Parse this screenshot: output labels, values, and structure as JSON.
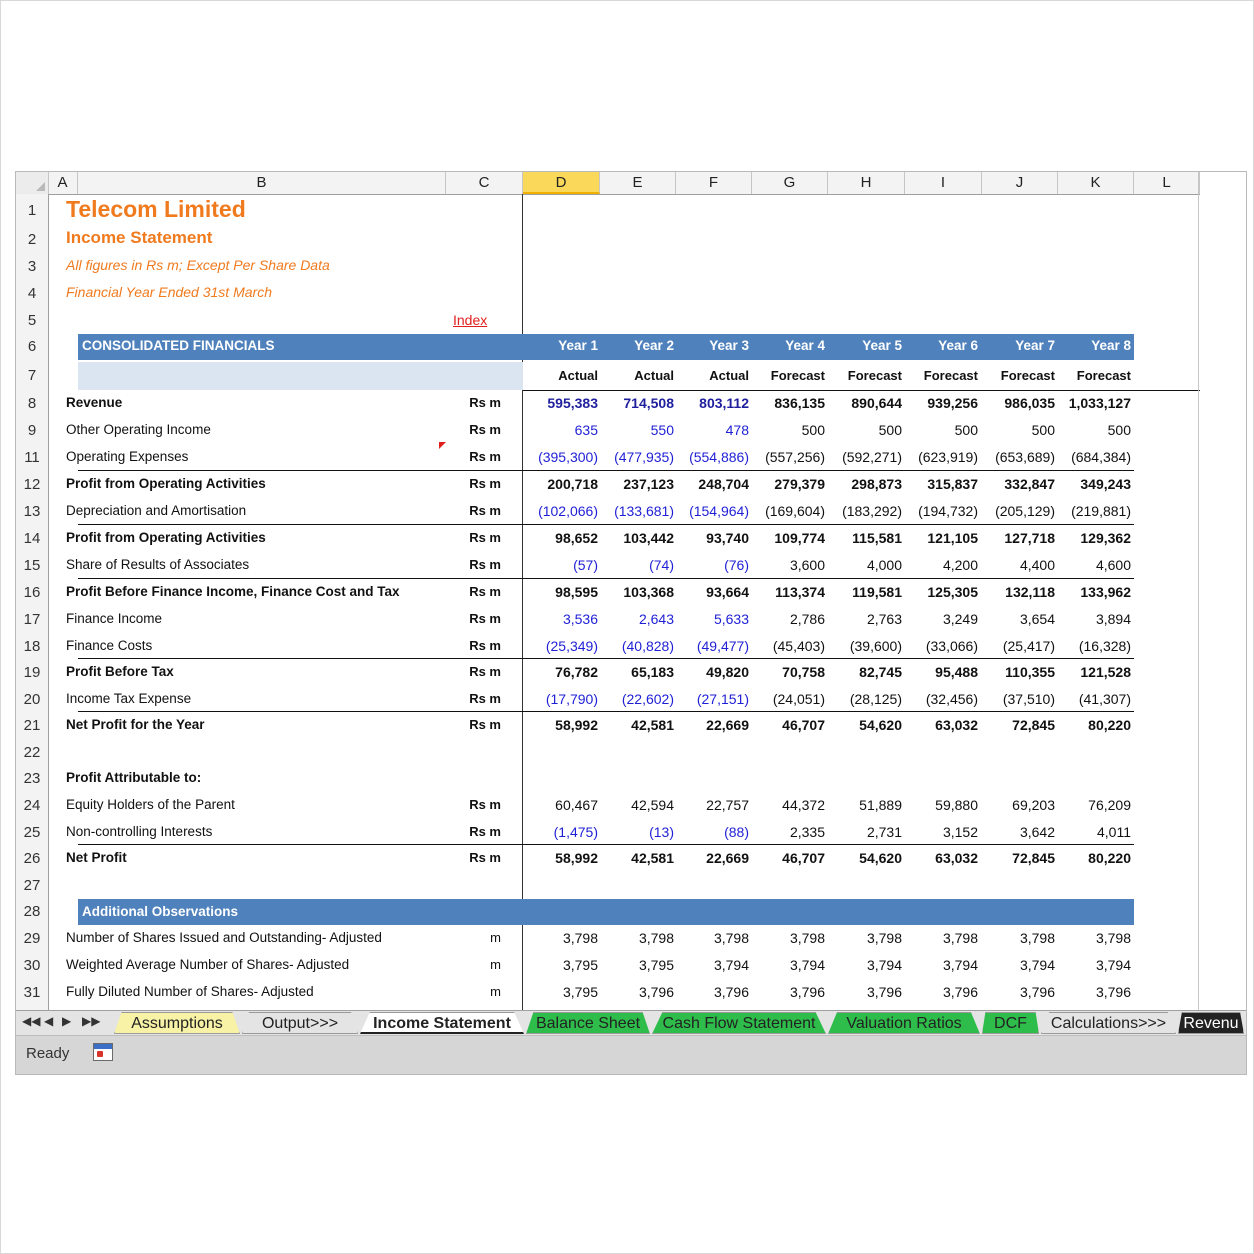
{
  "columns": [
    "A",
    "B",
    "C",
    "D",
    "E",
    "F",
    "G",
    "H",
    "I",
    "J",
    "K",
    "L"
  ],
  "selected_column": "D",
  "row_numbers": [
    "1",
    "2",
    "3",
    "4",
    "5",
    "6",
    "7",
    "8",
    "9",
    "11",
    "12",
    "13",
    "14",
    "15",
    "16",
    "17",
    "18",
    "19",
    "20",
    "21",
    "22",
    "23",
    "24",
    "25",
    "26",
    "27",
    "28",
    "29",
    "30",
    "31"
  ],
  "title": {
    "company": "Telecom Limited",
    "statement": "Income Statement",
    "note1": "All figures in Rs m; Except Per Share Data",
    "note2": "Financial Year Ended 31st March",
    "index_link": "Index"
  },
  "header": {
    "section": "CONSOLIDATED FINANCIALS",
    "years": [
      "Year 1",
      "Year 2",
      "Year 3",
      "Year 4",
      "Year 5",
      "Year 6",
      "Year 7",
      "Year 8"
    ],
    "types": [
      "Actual",
      "Actual",
      "Actual",
      "Forecast",
      "Forecast",
      "Forecast",
      "Forecast",
      "Forecast"
    ]
  },
  "rows": [
    {
      "label": "Revenue",
      "unit": "Rs m",
      "bold": true,
      "values": [
        "595,383",
        "714,508",
        "803,112",
        "836,135",
        "890,644",
        "939,256",
        "986,035",
        "1,033,127"
      ]
    },
    {
      "label": "Other Operating Income",
      "unit": "Rs m",
      "bold": false,
      "values": [
        "635",
        "550",
        "478",
        "500",
        "500",
        "500",
        "500",
        "500"
      ]
    },
    {
      "label": "Operating Expenses",
      "unit": "Rs m",
      "bold": false,
      "values": [
        "(395,300)",
        "(477,935)",
        "(554,886)",
        "(557,256)",
        "(592,271)",
        "(623,919)",
        "(653,689)",
        "(684,384)"
      ]
    },
    {
      "label": "Profit from Operating Activities",
      "unit": "Rs m",
      "bold": true,
      "values": [
        "200,718",
        "237,123",
        "248,704",
        "279,379",
        "298,873",
        "315,837",
        "332,847",
        "349,243"
      ]
    },
    {
      "label": "Depreciation and Amortisation",
      "unit": "Rs m",
      "bold": false,
      "values": [
        "(102,066)",
        "(133,681)",
        "(154,964)",
        "(169,604)",
        "(183,292)",
        "(194,732)",
        "(205,129)",
        "(219,881)"
      ]
    },
    {
      "label": "Profit from Operating Activities",
      "unit": "Rs m",
      "bold": true,
      "values": [
        "98,652",
        "103,442",
        "93,740",
        "109,774",
        "115,581",
        "121,105",
        "127,718",
        "129,362"
      ]
    },
    {
      "label": "Share of Results of Associates",
      "unit": "Rs m",
      "bold": false,
      "values": [
        "(57)",
        "(74)",
        "(76)",
        "3,600",
        "4,000",
        "4,200",
        "4,400",
        "4,600"
      ]
    },
    {
      "label": "Profit Before Finance Income, Finance Cost and Tax",
      "unit": "Rs m",
      "bold": true,
      "values": [
        "98,595",
        "103,368",
        "93,664",
        "113,374",
        "119,581",
        "125,305",
        "132,118",
        "133,962"
      ]
    },
    {
      "label": "Finance Income",
      "unit": "Rs m",
      "bold": false,
      "values": [
        "3,536",
        "2,643",
        "5,633",
        "2,786",
        "2,763",
        "3,249",
        "3,654",
        "3,894"
      ]
    },
    {
      "label": "Finance Costs",
      "unit": "Rs m",
      "bold": false,
      "values": [
        "(25,349)",
        "(40,828)",
        "(49,477)",
        "(45,403)",
        "(39,600)",
        "(33,066)",
        "(25,417)",
        "(16,328)"
      ]
    },
    {
      "label": "Profit Before Tax",
      "unit": "Rs m",
      "bold": true,
      "values": [
        "76,782",
        "65,183",
        "49,820",
        "70,758",
        "82,745",
        "95,488",
        "110,355",
        "121,528"
      ]
    },
    {
      "label": "Income Tax Expense",
      "unit": "Rs m",
      "bold": false,
      "values": [
        "(17,790)",
        "(22,602)",
        "(27,151)",
        "(24,051)",
        "(28,125)",
        "(32,456)",
        "(37,510)",
        "(41,307)"
      ]
    },
    {
      "label": "Net Profit for the Year",
      "unit": "Rs m",
      "bold": true,
      "values": [
        "58,992",
        "42,581",
        "22,669",
        "46,707",
        "54,620",
        "63,032",
        "72,845",
        "80,220"
      ]
    },
    {
      "label": "",
      "unit": "",
      "bold": false,
      "values": [
        "",
        "",
        "",
        "",
        "",
        "",
        "",
        ""
      ]
    },
    {
      "label": "Profit Attributable to:",
      "unit": "",
      "bold": true,
      "values": [
        "",
        "",
        "",
        "",
        "",
        "",
        "",
        ""
      ]
    },
    {
      "label": "Equity Holders of the Parent",
      "unit": "Rs m",
      "bold": false,
      "values": [
        "60,467",
        "42,594",
        "22,757",
        "44,372",
        "51,889",
        "59,880",
        "69,203",
        "76,209"
      ]
    },
    {
      "label": "Non-controlling Interests",
      "unit": "Rs m",
      "bold": false,
      "values": [
        "(1,475)",
        "(13)",
        "(88)",
        "2,335",
        "2,731",
        "3,152",
        "3,642",
        "4,011"
      ]
    },
    {
      "label": "Net Profit",
      "unit": "Rs m",
      "bold": true,
      "values": [
        "58,992",
        "42,581",
        "22,669",
        "46,707",
        "54,620",
        "63,032",
        "72,845",
        "80,220"
      ]
    }
  ],
  "observations": {
    "section": "Additional Observations",
    "rows": [
      {
        "label": "Number of Shares Issued and Outstanding- Adjusted",
        "unit": "m",
        "values": [
          "3,798",
          "3,798",
          "3,798",
          "3,798",
          "3,798",
          "3,798",
          "3,798",
          "3,798"
        ]
      },
      {
        "label": "Weighted Average Number of Shares- Adjusted",
        "unit": "m",
        "values": [
          "3,795",
          "3,795",
          "3,794",
          "3,794",
          "3,794",
          "3,794",
          "3,794",
          "3,794"
        ]
      },
      {
        "label": "Fully Diluted Number of Shares- Adjusted",
        "unit": "m",
        "values": [
          "3,795",
          "3,796",
          "3,796",
          "3,796",
          "3,796",
          "3,796",
          "3,796",
          "3,796"
        ]
      }
    ]
  },
  "tabs": [
    {
      "label": "Assumptions",
      "color": "#f7f2a6"
    },
    {
      "label": "Output>>>",
      "color": "#e4e4e4"
    },
    {
      "label": "Income Statement",
      "color": "#ffffff"
    },
    {
      "label": "Balance Sheet",
      "color": "#2ebd4a"
    },
    {
      "label": "Cash Flow Statement",
      "color": "#2ebd4a"
    },
    {
      "label": "Valuation Ratios",
      "color": "#2ebd4a"
    },
    {
      "label": "DCF",
      "color": "#2ebd4a"
    },
    {
      "label": "Calculations>>>",
      "color": "#e4e4e4"
    },
    {
      "label": "Revenu",
      "color": "#222222"
    }
  ],
  "status": {
    "text": "Ready"
  },
  "colors": {
    "accent_orange": "#f07a1e",
    "band_blue": "#4f81bd",
    "input_blue": "#1f1fd6",
    "tab_green": "#2ebd4a"
  }
}
